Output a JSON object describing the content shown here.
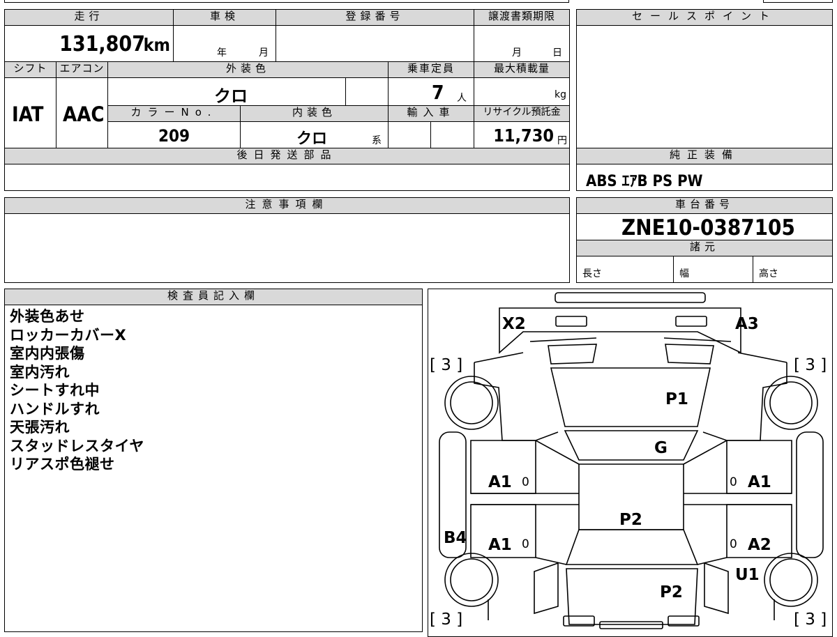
{
  "headers": {
    "mileage": "走行",
    "shaken": "車検",
    "reg_no": "登録番号",
    "transfer_deadline": "譲渡書類期限",
    "sales_point": "セールスポイント",
    "shift": "シフト",
    "aircon": "エアコン",
    "ext_color": "外装色",
    "capacity": "乗車定員",
    "max_load": "最大積載量",
    "color_no": "カラーNo.",
    "int_color": "内装色",
    "import": "輸入車",
    "recycle": "リサイクル預託金",
    "later_parts": "後日発送部品",
    "genuine_equipment": "純正装備",
    "caution": "注意事項欄",
    "chassis_no": "車台番号",
    "specs": "諸元",
    "inspector": "検査員記入欄"
  },
  "values": {
    "mileage": "131,807",
    "mileage_unit": "km",
    "shaken_year": "年",
    "shaken_month": "月",
    "deadline_month": "月",
    "deadline_day": "日",
    "shift": "IAT",
    "aircon": "AAC",
    "ext_color": "クロ",
    "capacity": "7",
    "capacity_unit": "人",
    "max_load_unit": "kg",
    "color_no": "209",
    "int_color": "クロ",
    "int_color_suffix": "系",
    "recycle": "11,730",
    "recycle_unit": "円",
    "genuine_equipment": "ABS ｴｱB PS PW",
    "chassis_no": "ZNE10-0387105",
    "length": "長さ",
    "width": "幅",
    "height": "高さ"
  },
  "inspector_notes": [
    "外装色あせ",
    "ロッカーカバーX",
    "室内内張傷",
    "室内汚れ",
    "シートすれ中",
    "ハンドルすれ",
    "天張汚れ",
    "スタッドレスタイヤ",
    "リアスポ色褪せ"
  ],
  "diagram": {
    "x2": "X2",
    "a3": "A3",
    "tire_fl": "[ 3 ]",
    "tire_fr": "[ 3 ]",
    "tire_rl": "[ 3 ]",
    "tire_rr": "[ 3 ]",
    "hood": "P1",
    "windshield": "G",
    "door_fl": "A1",
    "door_fr": "A1",
    "door_rl": "A1",
    "door_rr": "A2",
    "roof": "P2",
    "rocker_left": "B4",
    "rear_qtr_right": "U1",
    "rear": "P2",
    "zero_fl": "0",
    "zero_fr": "0",
    "zero_rl": "0",
    "zero_rr": "0"
  }
}
